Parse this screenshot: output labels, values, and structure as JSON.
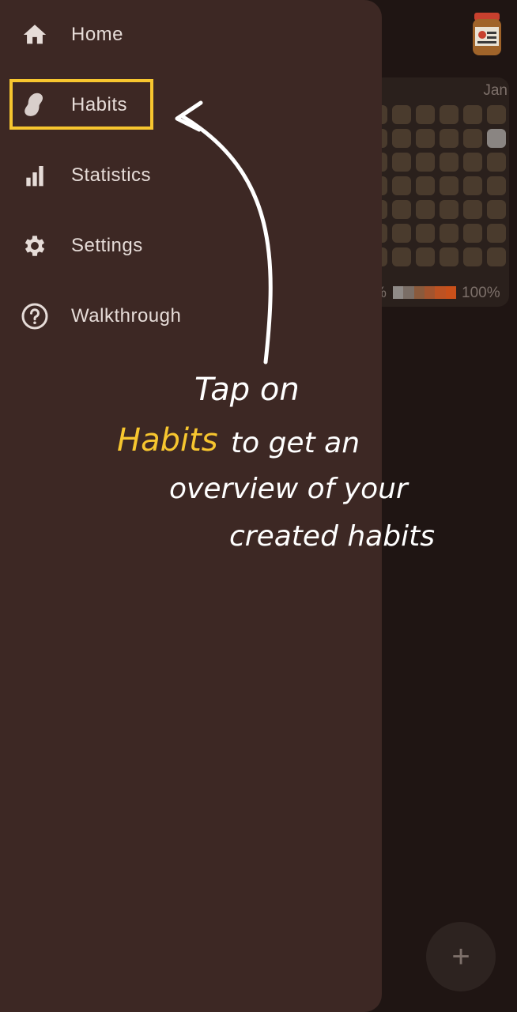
{
  "colors": {
    "background": "#1f1513",
    "drawer": "#3d2824",
    "highlight": "#f7c62f",
    "text": "#e6dcd8"
  },
  "nav": {
    "items": [
      {
        "label": "Home",
        "icon": "home-icon"
      },
      {
        "label": "Habits",
        "icon": "peanut-icon"
      },
      {
        "label": "Statistics",
        "icon": "bar-chart-icon"
      },
      {
        "label": "Settings",
        "icon": "gear-icon"
      },
      {
        "label": "Walkthrough",
        "icon": "help-circle-icon"
      }
    ],
    "highlighted": "Habits"
  },
  "background_app": {
    "month_label": "Jan",
    "legend_min": "%",
    "legend_max": "100%",
    "fab_label": "+",
    "avatar_icon": "peanut-butter-jar-icon"
  },
  "annotation": {
    "line1": "Tap on",
    "highlight_word": "Habits",
    "line2_rest": "to get an",
    "line3": "overview of your",
    "line4": "created habits"
  }
}
